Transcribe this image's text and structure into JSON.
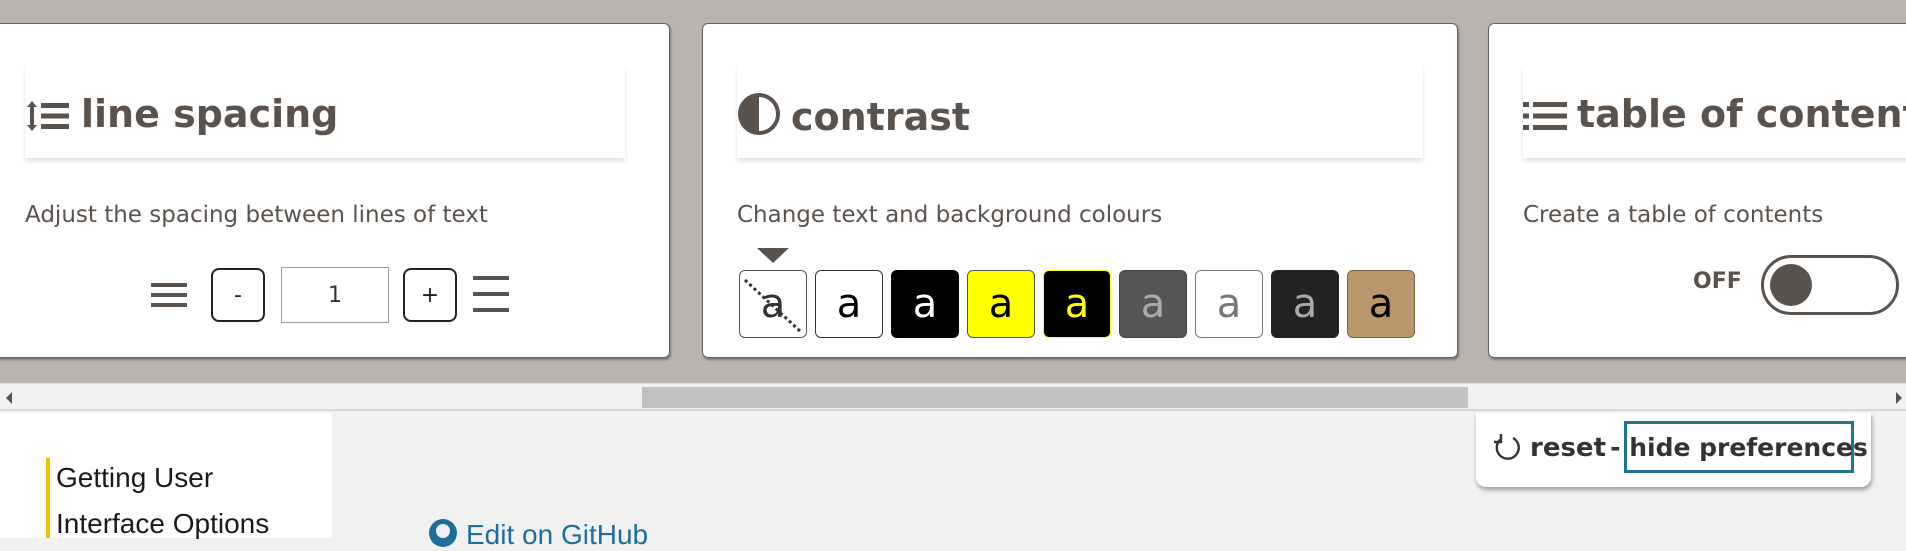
{
  "panels": {
    "line_spacing": {
      "title": "line spacing",
      "description": "Adjust the spacing between lines of text",
      "decrease_label": "-",
      "value": "1",
      "increase_label": "+"
    },
    "contrast": {
      "title": "contrast",
      "description": "Change text and background colours",
      "selected_index": 0,
      "swatches": [
        {
          "label": "a",
          "name": "default",
          "bg": "#ffffff",
          "fg": "#333333",
          "border": "#555555"
        },
        {
          "label": "a",
          "name": "black-on-white",
          "bg": "#ffffff",
          "fg": "#000000",
          "border": "#333333"
        },
        {
          "label": "a",
          "name": "white-on-black",
          "bg": "#000000",
          "fg": "#ffffff",
          "border": "#000000"
        },
        {
          "label": "a",
          "name": "black-on-yellow",
          "bg": "#ffff00",
          "fg": "#000000",
          "border": "#555555"
        },
        {
          "label": "a",
          "name": "yellow-on-black",
          "bg": "#000000",
          "fg": "#ffff00",
          "border": "#ffff00"
        },
        {
          "label": "a",
          "name": "light-on-grey",
          "bg": "#555555",
          "fg": "#aaaaaa",
          "border": "#444444"
        },
        {
          "label": "a",
          "name": "grey-on-white",
          "bg": "#ffffff",
          "fg": "#777777",
          "border": "#777777"
        },
        {
          "label": "a",
          "name": "grey-on-dark",
          "bg": "#222222",
          "fg": "#aaaaaa",
          "border": "#222222"
        },
        {
          "label": "a",
          "name": "black-on-tan",
          "bg": "#b8986a",
          "fg": "#000000",
          "border": "#7a6344"
        }
      ]
    },
    "toc": {
      "title": "table of contents",
      "description": "Create a table of contents",
      "toggle_label": "OFF"
    }
  },
  "sidebar": {
    "items": [
      "Getting User",
      "Interface Options"
    ]
  },
  "content": {
    "github_link": "Edit on GitHub"
  },
  "prefs_bar": {
    "reset_label": "reset",
    "hide_label": "- hide preferences"
  },
  "colors": {
    "prefs_bg": "#bbb3ad",
    "text": "#5a524d",
    "focus": "#1d7592",
    "toc_accent": "#f2c200",
    "link": "#1f6e9c"
  }
}
